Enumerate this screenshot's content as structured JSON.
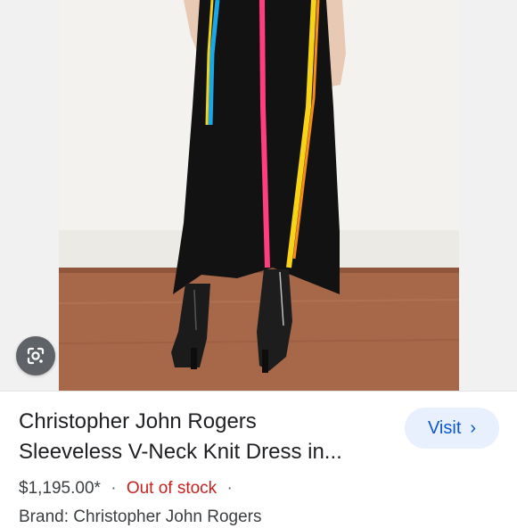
{
  "product": {
    "title_line1": "Christopher John Rogers",
    "title_line2": "Sleeveless V-Neck Knit Dress in...",
    "price": "$1,195.00*",
    "separator": "·",
    "stock_status": "Out of stock",
    "brand_partial": "Brand: Christopher John Rogers"
  },
  "actions": {
    "visit_label": "Visit",
    "visit_icon": "chevron-right-icon",
    "lens_icon": "google-lens-icon"
  },
  "colors": {
    "visit_bg": "#e8f0fe",
    "visit_text": "#0b57d0",
    "out_of_stock": "#c5221f",
    "title": "#202124"
  }
}
